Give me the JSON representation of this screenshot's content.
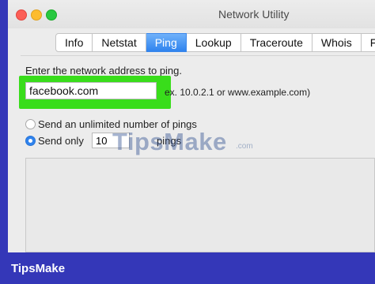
{
  "window": {
    "title": "Network Utility"
  },
  "tabs": [
    {
      "label": "Info"
    },
    {
      "label": "Netstat"
    },
    {
      "label": "Ping",
      "active": true
    },
    {
      "label": "Lookup"
    },
    {
      "label": "Traceroute"
    },
    {
      "label": "Whois"
    },
    {
      "label": "Fin"
    }
  ],
  "ping": {
    "prompt": "Enter the network address to ping.",
    "address_value": "facebook.com",
    "example_hint": "ex. 10.0.2.1 or www.example.com)",
    "option_unlimited": "Send an unlimited number of pings",
    "option_send_only": "Send only",
    "count_value": "10",
    "pings_suffix": "pings",
    "selected_option": "send_only"
  },
  "watermark": {
    "text": "TipsMake",
    "suffix": ".com"
  },
  "footer": {
    "brand": "TipsMake"
  },
  "colors": {
    "background": "#3437b8",
    "highlight": "#39dd1b",
    "active_tab": "#2f83ee"
  }
}
